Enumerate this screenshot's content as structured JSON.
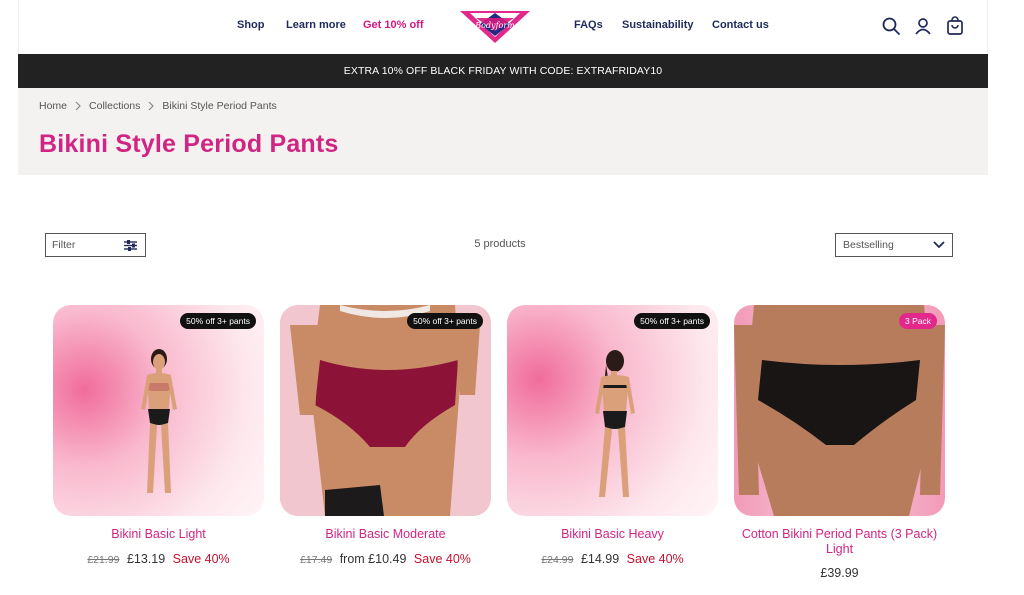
{
  "header": {
    "nav_left": [
      "Shop",
      "Learn more",
      "Get 10% off"
    ],
    "nav_right": [
      "FAQs",
      "Sustainability",
      "Contact us"
    ],
    "logo_text": "Bodyform",
    "icons": [
      "search-icon",
      "account-icon",
      "cart-icon"
    ],
    "accent_color": "#d8187f",
    "nav_color": "#1f2a5a"
  },
  "promo": {
    "text": "EXTRA 10% OFF BLACK FRIDAY WITH CODE: EXTRAFRIDAY10"
  },
  "breadcrumb": [
    "Home",
    "Collections",
    "Bikini Style Period Pants"
  ],
  "page_title": "Bikini Style Period Pants",
  "toolbar": {
    "filter_label": "Filter",
    "product_count": "5 products",
    "sort_label": "Bestselling"
  },
  "products": [
    {
      "name": "Bikini Basic Light",
      "badge": "50% off 3+ pants",
      "was": "£21.99",
      "price": "£13.19",
      "save": "Save 40%"
    },
    {
      "name": "Bikini Basic Moderate",
      "badge": "50% off 3+ pants",
      "was": "£17.49",
      "price": "from £10.49",
      "save": "Save 40%"
    },
    {
      "name": "Bikini Basic Heavy",
      "badge": "50% off 3+ pants",
      "was": "£24.99",
      "price": "£14.99",
      "save": "Save 40%"
    },
    {
      "name": "Cotton Bikini Period Pants (3 Pack) Light",
      "badge": "3 Pack",
      "price": "£39.99"
    }
  ]
}
